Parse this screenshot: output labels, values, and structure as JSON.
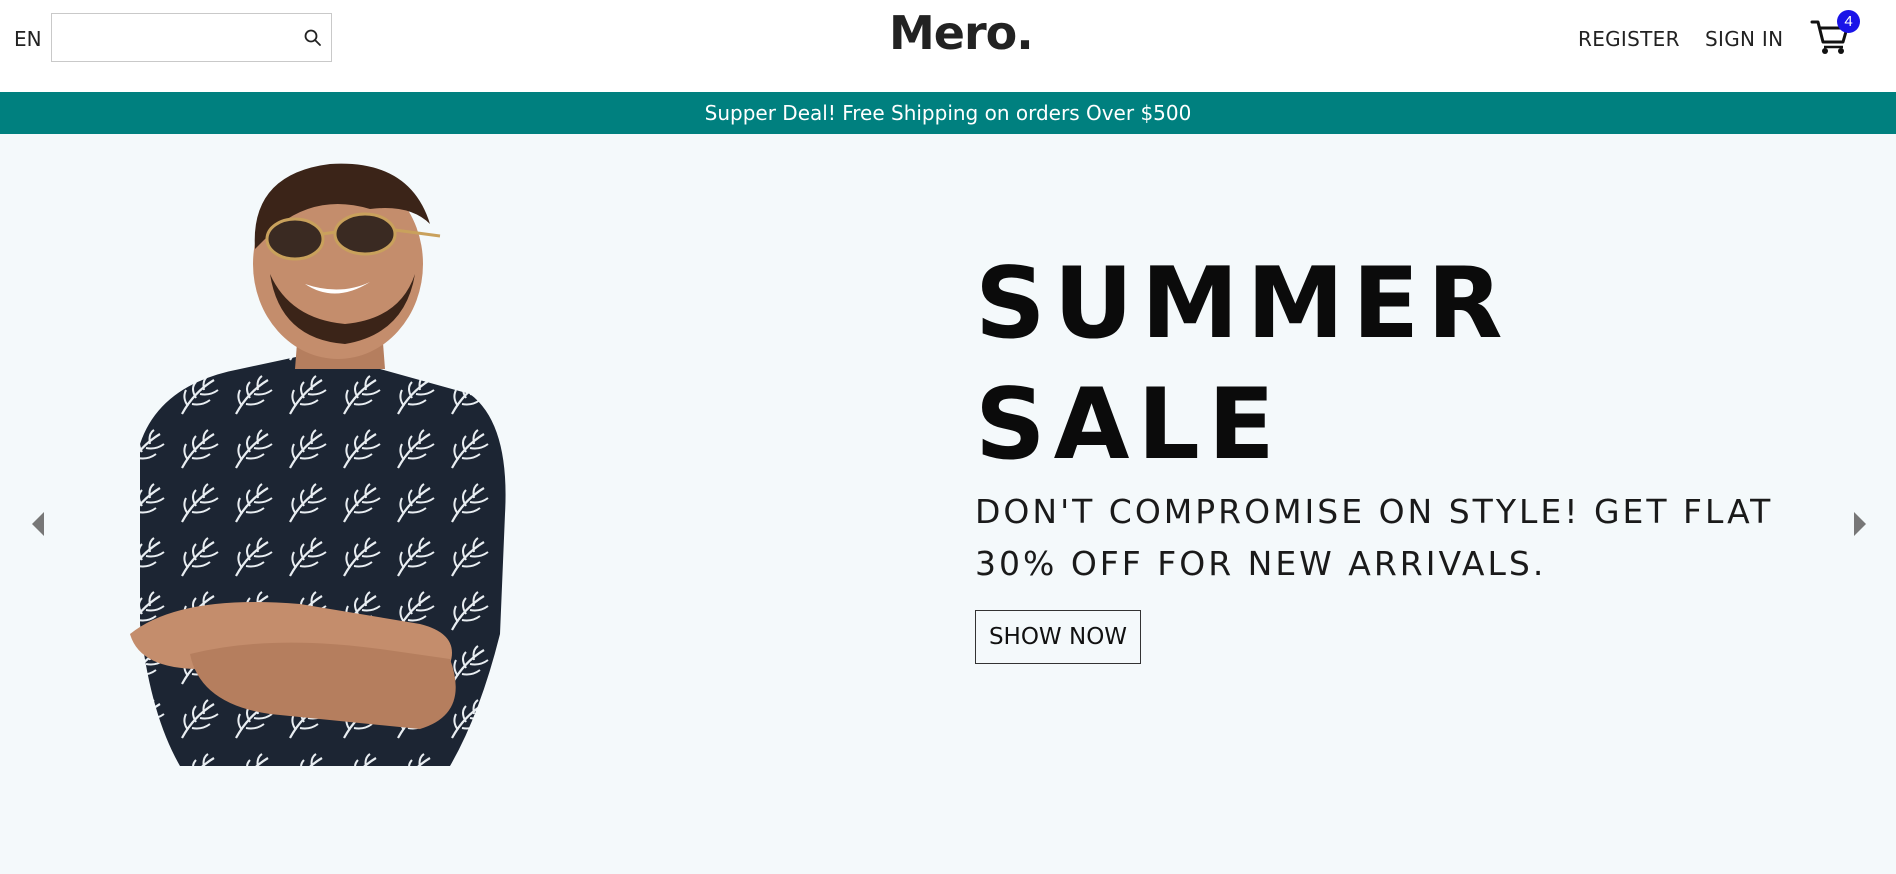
{
  "navbar": {
    "language": "EN",
    "search": {
      "value": "",
      "placeholder": ""
    },
    "logo": "Mero.",
    "register_label": "REGISTER",
    "signin_label": "SIGN IN",
    "cart_count": "4",
    "cart_icon": "shopping-cart-icon",
    "search_icon": "search-icon"
  },
  "announcement": {
    "text": "Supper Deal! Free Shipping on orders Over $500",
    "background": "#00807f"
  },
  "hero": {
    "title_line1": "SUMMER",
    "title_line2": "SALE",
    "subtitle": "DON'T COMPROMISE ON STYLE! GET FLAT 30% OFF FOR NEW ARRIVALS.",
    "button_label": "SHOW NOW",
    "background": "#f4f9fb",
    "left_arrow_icon": "arrow-left-icon",
    "right_arrow_icon": "arrow-right-icon"
  },
  "colors": {
    "accent": "#00807f",
    "badge": "#1a14e8"
  }
}
